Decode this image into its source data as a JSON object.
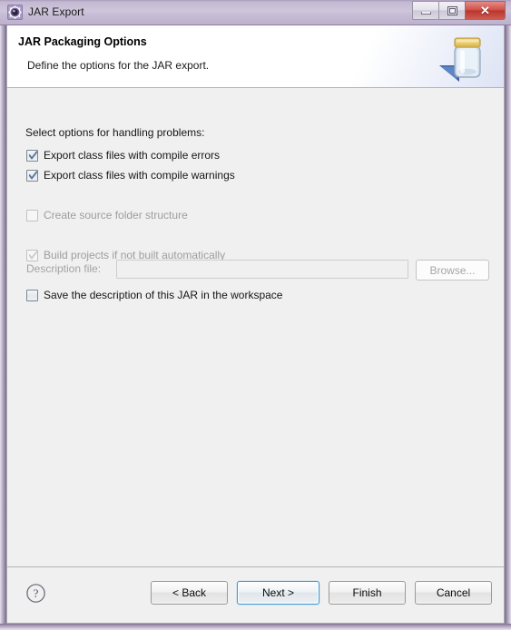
{
  "window": {
    "title": "JAR Export",
    "icon": "gear-icon",
    "controls": {
      "minimize": "minimize-icon",
      "maximize": "maximize-icon",
      "close": "✕"
    }
  },
  "header": {
    "title": "JAR Packaging Options",
    "description": "Define the options for the JAR export.",
    "icon": "jar-export-icon"
  },
  "body": {
    "group_label": "Select options for handling problems:",
    "options": [
      {
        "label": "Export class files with compile errors",
        "checked": true,
        "enabled": true
      },
      {
        "label": "Export class files with compile warnings",
        "checked": true,
        "enabled": true
      },
      {
        "label": "Create source folder structure",
        "checked": false,
        "enabled": false
      },
      {
        "label": "Build projects if not built automatically",
        "checked": true,
        "enabled": false
      },
      {
        "label": "Save the description of this JAR in the workspace",
        "checked": false,
        "enabled": true
      }
    ],
    "description_file": {
      "label": "Description file:",
      "value": "",
      "placeholder": "",
      "browse_label": "Browse...",
      "enabled": false
    }
  },
  "footer": {
    "help_label": "?",
    "buttons": [
      {
        "label": "< Back",
        "default": false
      },
      {
        "label": "Next >",
        "default": true
      },
      {
        "label": "Finish",
        "default": false
      },
      {
        "label": "Cancel",
        "default": false
      }
    ]
  },
  "colors": {
    "frame": "#b7abc4",
    "titlebar": "#cfc6dc",
    "body": "#f0f0f0",
    "header_band": "#ffffff",
    "accent_focus": "#3c9ad4",
    "close_button": "#cc463c",
    "disabled_text": "#9d9d9d"
  }
}
